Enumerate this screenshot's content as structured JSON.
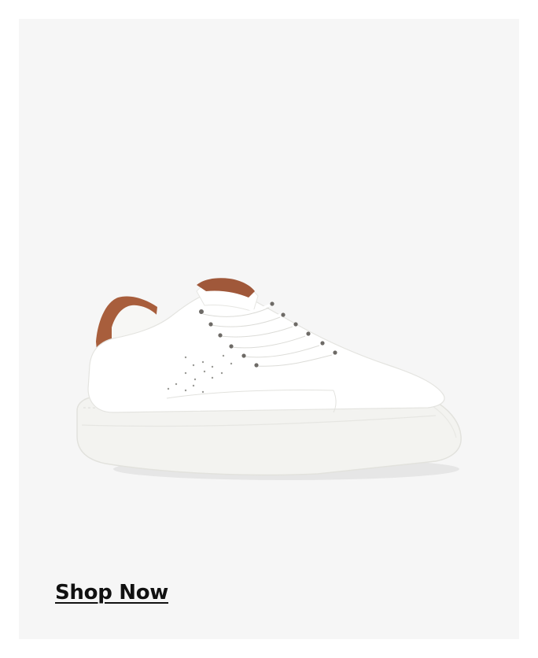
{
  "promo": {
    "cta_label": "Shop Now"
  },
  "product": {
    "image_subject": "white-leather-sneaker-with-brown-heel-tab",
    "colors": {
      "background": "#f6f6f6",
      "upper": "#ffffff",
      "heel_tab": "#a85e3c",
      "sole": "#f2f2ef"
    }
  }
}
